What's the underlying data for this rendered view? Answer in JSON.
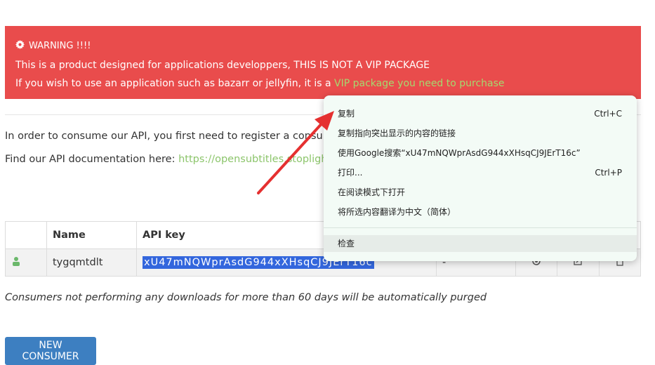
{
  "warning": {
    "title": "WARNING !!!!",
    "line1": "This is a product designed for applications developpers, THIS IS NOT A VIP PACKAGE",
    "line2_prefix": "If you wish to use an application such as bazarr or jellyfin, it is a ",
    "line2_link": "VIP package you need to purchase"
  },
  "intro": {
    "register_text": "In order to consume our API, you first need to register a consumer",
    "docs_prefix": "Find our API documentation here: ",
    "docs_link": "https://opensubtitles.stoplight.io"
  },
  "table": {
    "headers": [
      "Name",
      "API key"
    ],
    "rows": [
      {
        "name": "tygqmtdlt",
        "api_key": "xU47mNQWprAsdG944xXHsqCJ9JErT16c",
        "extra": "-"
      }
    ]
  },
  "note": "Consumers not performing any downloads for more than 60 days will be automatically purged",
  "new_consumer_button": "NEW CONSUMER",
  "context_menu": {
    "items": [
      {
        "label": "复制",
        "shortcut": "Ctrl+C"
      },
      {
        "label": "复制指向突出显示的内容的链接",
        "shortcut": ""
      },
      {
        "label": "使用Google搜索“xU47mNQWprAsdG944xXHsqCJ9JErT16c”",
        "shortcut": ""
      },
      {
        "label": "打印...",
        "shortcut": "Ctrl+P"
      },
      {
        "label": "在阅读模式下打开",
        "shortcut": ""
      },
      {
        "label": "将所选内容翻译为中文（简体）",
        "shortcut": ""
      },
      {
        "label": "检查",
        "shortcut": ""
      }
    ]
  },
  "colors": {
    "warning_bg": "#e94c4c",
    "link_green": "#8cc56b",
    "button_blue": "#3d7fc1",
    "selection_blue": "#3366dd",
    "annotation_arrow": "#e53030"
  }
}
